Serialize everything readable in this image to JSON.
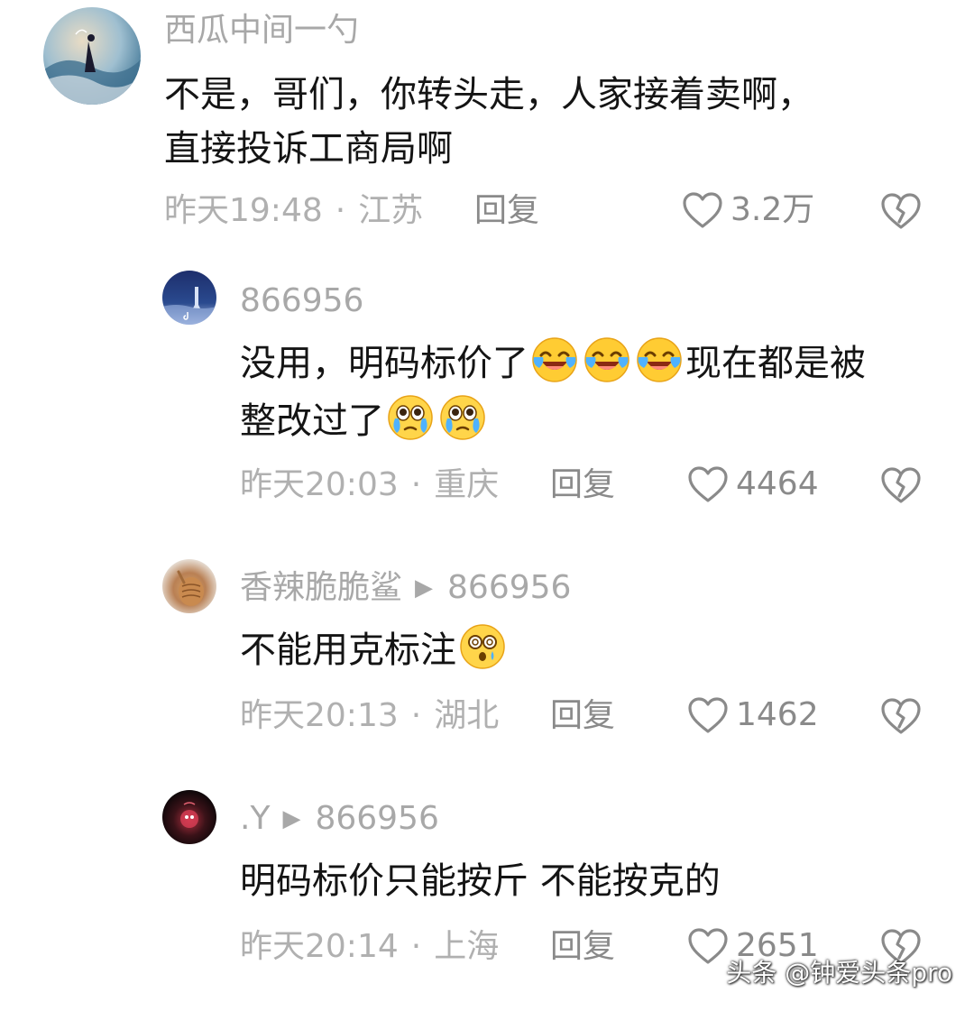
{
  "comments": [
    {
      "username": "西瓜中间一勺",
      "text_line1": "不是，哥们，你转头走，人家接着卖啊，",
      "text_line2": "直接投诉工商局啊",
      "time": "昨天19:48",
      "location": "江苏",
      "reply_label": "回复",
      "likes": "3.2万"
    },
    {
      "username": "866956",
      "text_line1": "没用，明码标价了",
      "text_line1_tail": "现在都是被",
      "text_line2": "整改过了",
      "time": "昨天20:03",
      "location": "重庆",
      "reply_label": "回复",
      "likes": "4464",
      "emojis_line1": [
        "laughing-crying-emoji",
        "laughing-crying-emoji",
        "laughing-crying-emoji"
      ],
      "emojis_line2": [
        "teary-eyes-emoji",
        "teary-eyes-emoji"
      ]
    },
    {
      "username": "香辣脆脆鲨",
      "reply_to": "866956",
      "text_line1": "不能用克标注",
      "time": "昨天20:13",
      "location": "湖北",
      "reply_label": "回复",
      "likes": "1462",
      "emojis_line1": [
        "dizzy-face-emoji"
      ]
    },
    {
      "username": ".Y",
      "reply_to": "866956",
      "text_line1": "明码标价只能按斤 不能按克的",
      "time": "昨天20:14",
      "location": "上海",
      "reply_label": "回复",
      "likes": "2651"
    }
  ],
  "separator": "·",
  "reply_arrow": "▶",
  "watermark": "头条 @钟爱头条pro",
  "colors": {
    "username": "#a8a8a8",
    "text": "#141414",
    "meta": "#b0b0b0",
    "action": "#8a8a8a"
  }
}
